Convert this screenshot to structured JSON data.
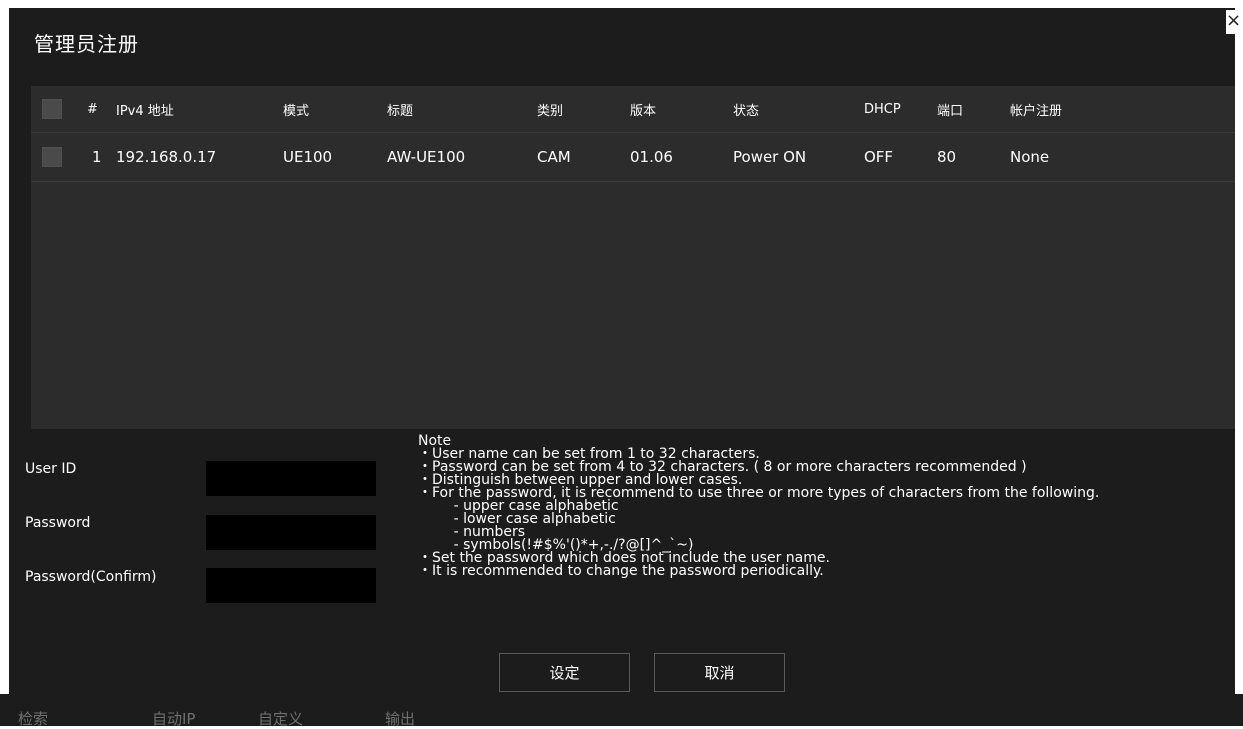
{
  "dialog": {
    "title": "管理员注册",
    "close_glyph": "×"
  },
  "underlay": {
    "items": [
      "检索",
      "自动IP",
      "自定义",
      "输出"
    ]
  },
  "table": {
    "headers": {
      "num": "#",
      "ipv4": "IPv4 地址",
      "model": "模式",
      "title": "标题",
      "category": "类别",
      "version": "版本",
      "status": "状态",
      "dhcp": "DHCP",
      "port": "端口",
      "account": "帐户注册"
    },
    "rows": [
      {
        "num": "1",
        "ipv4": "192.168.0.17",
        "model": "UE100",
        "title": "AW-UE100",
        "category": "CAM",
        "version": "01.06",
        "status": "Power ON",
        "dhcp": "OFF",
        "port": "80",
        "account": "None"
      }
    ]
  },
  "form": {
    "user_id_label": "User ID",
    "password_label": "Password",
    "password_confirm_label": "Password(Confirm)",
    "user_id_value": "",
    "password_value": "",
    "password_confirm_value": ""
  },
  "note": {
    "lines": [
      "Note",
      "・User name can be set from 1 to 32 characters.",
      "・Password can be set from 4 to 32 characters. ( 8 or more characters recommended )",
      "・Distinguish between upper and lower cases.",
      "・For the password, it is recommend to use three or more types of characters from the following.",
      "        - upper case alphabetic",
      "        - lower case alphabetic",
      "        - numbers",
      "        - symbols(!#$%'()*+,-./?@[]^_`~)",
      "・Set the password which does not include the user name.",
      "・It is recommended to change the password periodically."
    ]
  },
  "buttons": {
    "set_label": "设定",
    "cancel_label": "取消"
  },
  "colors": {
    "dialog_bg": "#1c1c1c",
    "table_bg": "#2c2c2c",
    "input_bg": "#000000",
    "text": "#ffffff"
  }
}
